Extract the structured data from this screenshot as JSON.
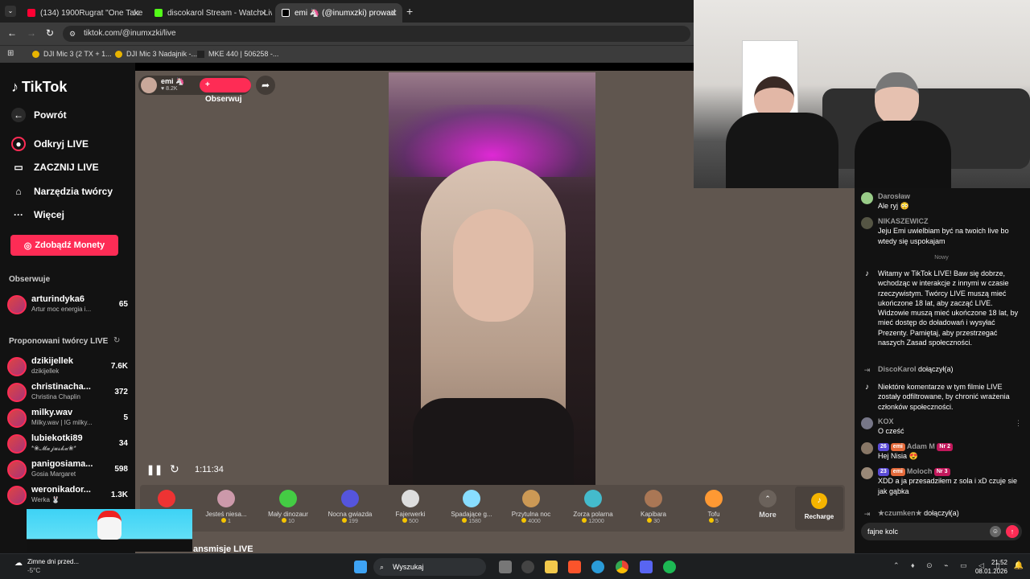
{
  "tabs": [
    {
      "title": "(134) 1900Rugrat \"One Take Fre",
      "color": "#ff0033"
    },
    {
      "title": "discokarol Stream - Watch Live",
      "color": "#53fc18"
    },
    {
      "title": "emi 🦄 (@inumxzki) prowad",
      "color": "#222"
    }
  ],
  "url": "tiktok.com/@inumxzki/live",
  "bookmarks": [
    "DJI Mic 3 (2 TX + 1...",
    "DJI Mic 3 Nadajnik -...",
    "MKE 440 | 506258 -..."
  ],
  "sidebar": {
    "logo": "TikTok",
    "back": "Powrót",
    "nav": [
      "Odkryj LIVE",
      "ZACZNIJ LIVE",
      "Narzędzia twórcy",
      "Więcej"
    ],
    "coins": "Zdobądź Monety",
    "following_head": "Obserwuje",
    "following": [
      {
        "name": "arturindyka6",
        "sub": "Artur moc energia i...",
        "count": "65"
      }
    ],
    "suggested_head": "Proponowani twórcy LIVE",
    "suggested": [
      {
        "name": "dzikijellek",
        "sub": "dzikijellek",
        "count": "7.6K"
      },
      {
        "name": "christinacha...",
        "sub": "Christina Chaplin",
        "count": "372"
      },
      {
        "name": "milky.wav",
        "sub": "Milky.wav | IG milky...",
        "count": "5"
      },
      {
        "name": "lubiekotki89",
        "sub": "*❀𝓜𝓪𝓳𝓾𝓼𝓴𝓪❀*",
        "count": "34"
      },
      {
        "name": "panigosiama...",
        "sub": "Gosia Margaret",
        "count": "598"
      },
      {
        "name": "weronikador...",
        "sub": "Werka 🐰",
        "count": "1.3K"
      }
    ]
  },
  "stream": {
    "host": "emi 🦄",
    "viewers": "8.2K",
    "follow": "+ Obserwuj",
    "time": "1:11:34",
    "below": "ansmisje LIVE"
  },
  "gifts": [
    {
      "name": "",
      "price": "",
      "color": "#e33"
    },
    {
      "name": "Jesteś niesa...",
      "price": "1",
      "color": "#c9a"
    },
    {
      "name": "Mały dinozaur",
      "price": "10",
      "color": "#4c4"
    },
    {
      "name": "Nocna gwiazda",
      "price": "199",
      "color": "#55d"
    },
    {
      "name": "Fajerwerki",
      "price": "500",
      "color": "#ddd"
    },
    {
      "name": "Spadające g...",
      "price": "1580",
      "color": "#8df"
    },
    {
      "name": "Przytulna noc",
      "price": "4000",
      "color": "#c95"
    },
    {
      "name": "Zorza polarna",
      "price": "12000",
      "color": "#4bc"
    },
    {
      "name": "Kapibara",
      "price": "30",
      "color": "#a75"
    },
    {
      "name": "Tofu",
      "price": "5",
      "color": "#f93"
    }
  ],
  "gift_more": "More",
  "recharge": "Recharge",
  "chat": {
    "new_divider": "Nowy",
    "input": "fajne kolc",
    "messages": [
      {
        "user": "Darosław",
        "text": "Ale ryj 😳"
      },
      {
        "user": "NIKASZEWICZ",
        "text": "Jeju Emi uwielbiam być na twoich live bo wtedy się uspokajam"
      },
      {
        "user": "",
        "text": "Witamy w TikTok LIVE! Baw się dobrze, wchodząc w interakcje z innymi w czasie rzeczywistym. Twórcy LIVE muszą mieć ukończone 18 lat, aby zacząć LIVE. Widzowie muszą mieć ukończone 18 lat, by mieć dostęp do doładowań i wysyłać Prezenty. Pamiętaj, aby przestrzegać naszych Zasad społeczności."
      },
      {
        "user": "DiscoKarol",
        "text": "dołączył(a)"
      },
      {
        "user": "",
        "text": "Niektóre komentarze w tym filmie LIVE zostały odfiltrowane, by chronić wrażenia członków społeczności."
      },
      {
        "user": "KOX",
        "text": "O cześć"
      },
      {
        "user": "Adam M",
        "text": "Hej Nisia 😍",
        "b1": "26",
        "b2": "emi",
        "b3": "Nr 2"
      },
      {
        "user": "Moloch",
        "text": "XDD a ja przesadziłem z sola i xD czuje sie jak gąbka",
        "b1": "23",
        "b2": "emi",
        "b3": "Nr 3"
      },
      {
        "user": "★czumken★",
        "text": "dołączył(a)"
      }
    ]
  },
  "taskbar": {
    "weather_title": "Zimne dni przed...",
    "weather_temp": "-5°C",
    "search": "Wyszukaj",
    "time": "21:52",
    "date": "08.01.2026"
  }
}
